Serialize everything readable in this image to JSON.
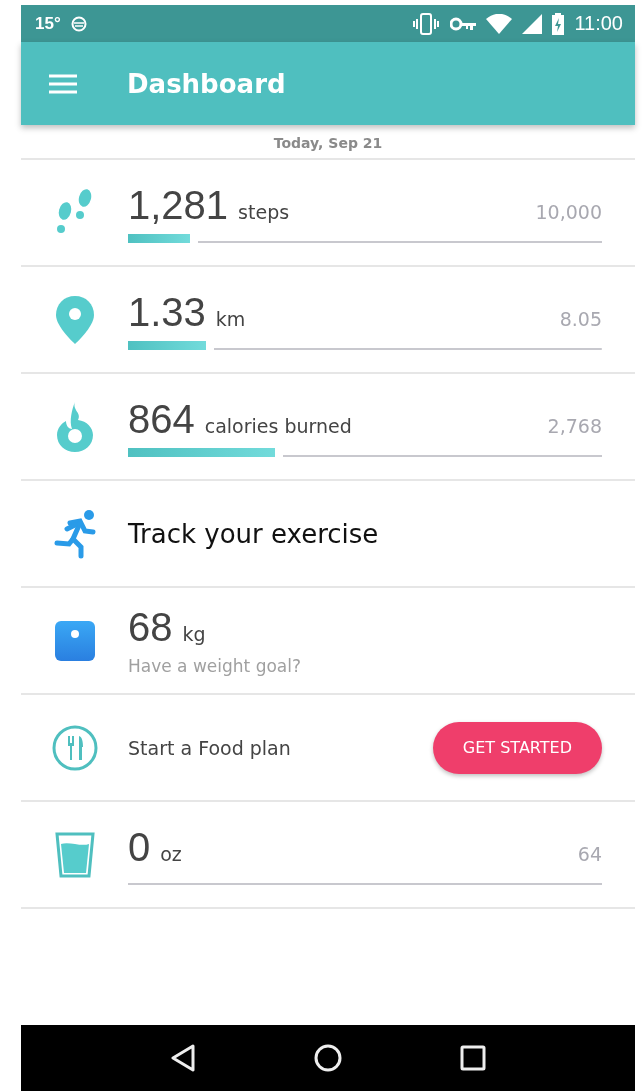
{
  "status_bar": {
    "temperature": "15°",
    "time": "11:00"
  },
  "app_bar": {
    "title": "Dashboard"
  },
  "date": "Today, Sep 21",
  "rows": [
    {
      "kind": "metric",
      "value": "1,281",
      "unit": "steps",
      "target": "10,000",
      "level": 0.13
    },
    {
      "kind": "metric",
      "value": "1.33",
      "unit": "km",
      "target": "8.05",
      "level": 0.165
    },
    {
      "kind": "metric",
      "value": "864",
      "unit": "calories burned",
      "target": "2,768",
      "level": 0.31
    },
    {
      "kind": "action",
      "label": "Track your exercise"
    },
    {
      "kind": "weight",
      "value": "68",
      "unit": "kg",
      "hint": "Have a weight goal?"
    },
    {
      "kind": "food",
      "label": "Start a Food plan",
      "button": "GET STARTED"
    },
    {
      "kind": "metric",
      "value": "0",
      "unit": "oz",
      "target": "64"
    }
  ]
}
